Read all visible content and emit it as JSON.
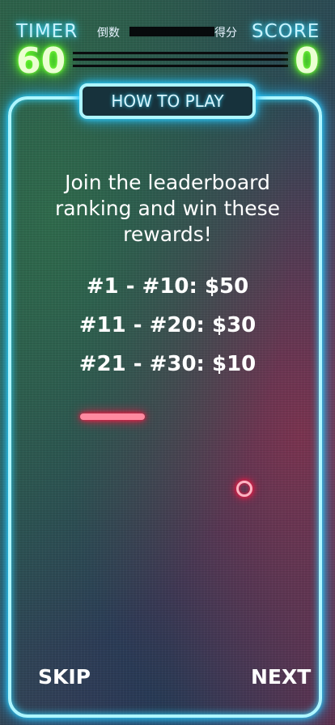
{
  "hud": {
    "timer_label": "TIMER",
    "timer_sub": "倒数",
    "score_sub": "得分",
    "score_label": "SCORE",
    "timer_value": "60",
    "score_value": "0"
  },
  "panel": {
    "title": "HOW TO PLAY",
    "intro": "Join the leaderboard ranking and win these rewards!",
    "rewards": [
      "#1 - #10: $50",
      "#11 - #20: $30",
      "#21 - #30: $10"
    ]
  },
  "nav": {
    "skip": "SKIP",
    "next": "NEXT"
  },
  "colors": {
    "neon_blue": "#2fd6ff",
    "neon_green": "#58ff20",
    "neon_red": "#ff1744"
  }
}
